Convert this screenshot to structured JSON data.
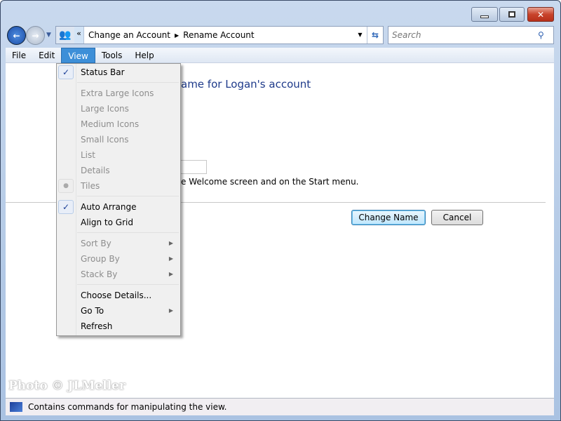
{
  "window": {
    "controls": {
      "minimize": "minimize-icon",
      "maximize": "maximize-icon",
      "close": "close-icon"
    }
  },
  "address": {
    "chevron": "«",
    "crumbs": [
      "Change an Account",
      "Rename Account"
    ]
  },
  "search": {
    "placeholder": "Search"
  },
  "menubar": [
    "File",
    "Edit",
    "View",
    "Tools",
    "Help"
  ],
  "view_menu": [
    {
      "label": "Status Bar",
      "state": "checked"
    },
    {
      "sep": true
    },
    {
      "label": "Extra Large Icons",
      "disabled": true
    },
    {
      "label": "Large Icons",
      "disabled": true
    },
    {
      "label": "Medium Icons",
      "disabled": true
    },
    {
      "label": "Small Icons",
      "disabled": true
    },
    {
      "label": "List",
      "disabled": true
    },
    {
      "label": "Details",
      "disabled": true
    },
    {
      "label": "Tiles",
      "disabled": true,
      "state": "radio"
    },
    {
      "sep": true
    },
    {
      "label": "Auto Arrange",
      "state": "checked"
    },
    {
      "label": "Align to Grid"
    },
    {
      "sep": true
    },
    {
      "label": "Sort By",
      "disabled": true,
      "submenu": true
    },
    {
      "label": "Group By",
      "disabled": true,
      "submenu": true
    },
    {
      "label": "Stack By",
      "disabled": true,
      "submenu": true
    },
    {
      "sep": true
    },
    {
      "label": "Choose Details..."
    },
    {
      "label": "Go To",
      "submenu": true
    },
    {
      "label": "Refresh"
    }
  ],
  "content": {
    "heading_fragment": "ame for Logan's account",
    "note_fragment": "e Welcome screen and on the Start menu.",
    "change_name": "Change Name",
    "cancel": "Cancel"
  },
  "watermark": "Photo © JLMeller",
  "status": {
    "text": "Contains commands for manipulating the view."
  }
}
